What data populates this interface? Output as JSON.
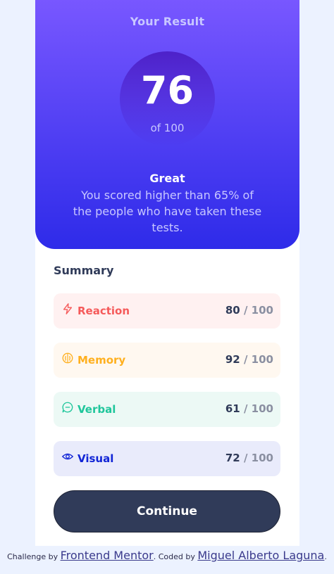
{
  "result": {
    "title": "Your Result",
    "score": "76",
    "out_of": "of 100",
    "rating": "Great",
    "description": "You scored higher than 65% of the people who have taken these tests."
  },
  "summary": {
    "title": "Summary",
    "items": [
      {
        "label": "Reaction",
        "score": "80",
        "max": "/ 100",
        "icon": "lightning-icon",
        "color": "#f55a5a",
        "bg": "#fff1f1"
      },
      {
        "label": "Memory",
        "score": "92",
        "max": "/ 100",
        "icon": "brain-icon",
        "color": "#ffb01f",
        "bg": "#fff8f0"
      },
      {
        "label": "Verbal",
        "score": "61",
        "max": "/ 100",
        "icon": "chat-bubble-icon",
        "color": "#1fc69b",
        "bg": "#ecf9f5"
      },
      {
        "label": "Visual",
        "score": "72",
        "max": "/ 100",
        "icon": "eye-icon",
        "color": "#1125d6",
        "bg": "#e9ebfb"
      }
    ]
  },
  "continue_label": "Continue",
  "footer": {
    "challenge_prefix": "Challenge by",
    "challenge_link": "Frontend Mentor",
    "coded_prefix": ". Coded by",
    "coded_link": "Miguel Alberto Laguna",
    "suffix": "."
  }
}
